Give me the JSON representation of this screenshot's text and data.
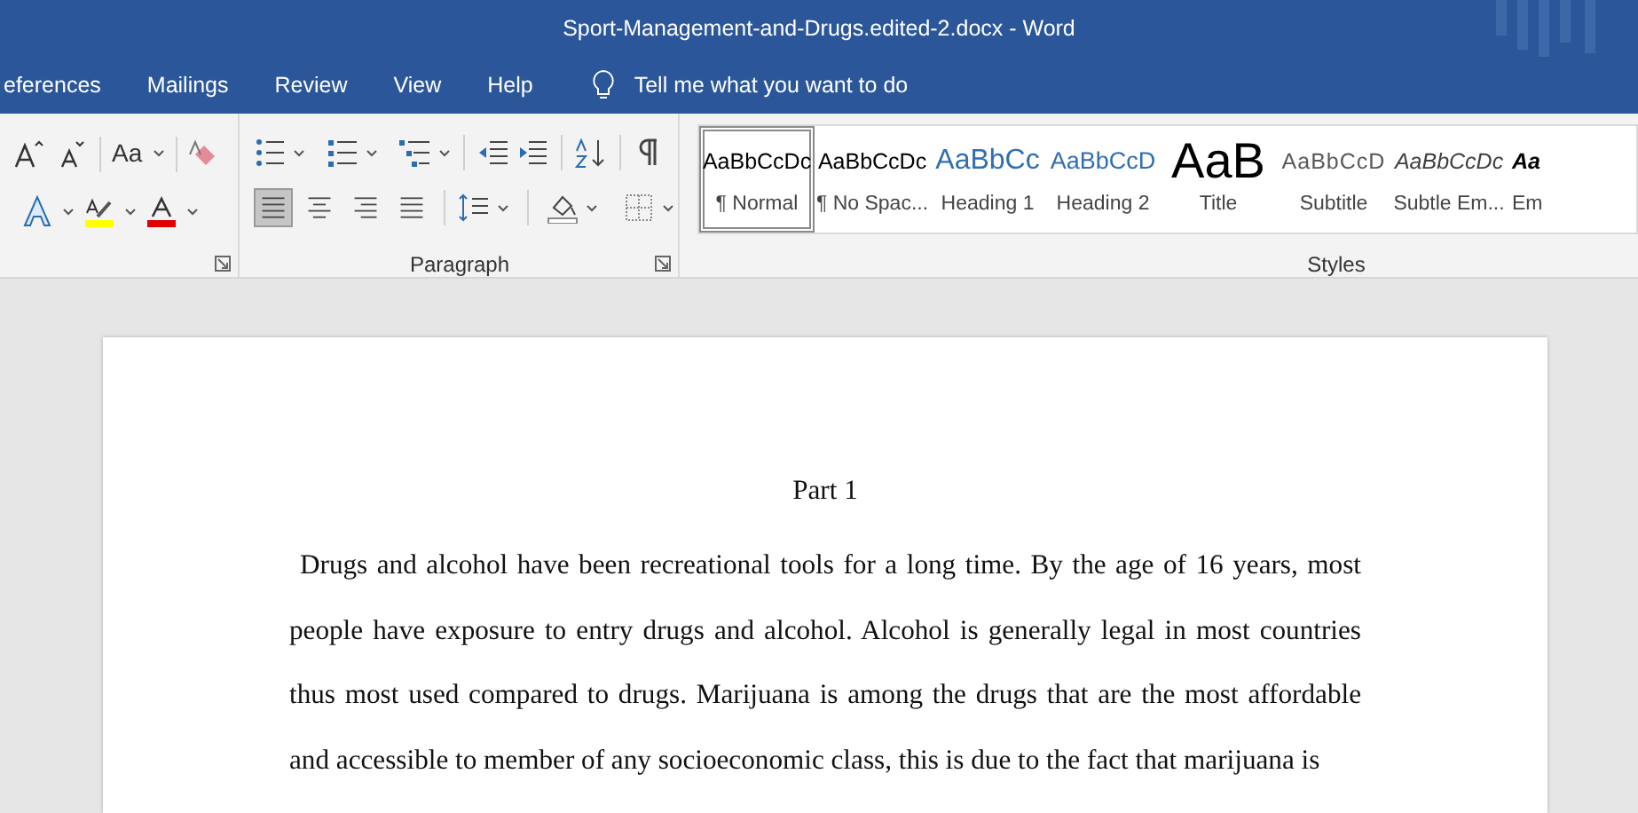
{
  "window": {
    "title": "Sport-Management-and-Drugs.edited-2.docx  -  Word"
  },
  "tabs": [
    {
      "label": "eferences",
      "selected": false
    },
    {
      "label": "Mailings",
      "selected": false
    },
    {
      "label": "Review",
      "selected": false
    },
    {
      "label": "View",
      "selected": false
    },
    {
      "label": "Help",
      "selected": false
    }
  ],
  "tell_me": {
    "placeholder": "Tell me what you want to do"
  },
  "font_group": {
    "change_case": "Aa"
  },
  "paragraph_group": {
    "label": "Paragraph",
    "alignment": [
      {
        "kind": "left",
        "selected": true
      },
      {
        "kind": "center",
        "selected": false
      },
      {
        "kind": "right",
        "selected": false
      },
      {
        "kind": "justify",
        "selected": false
      }
    ]
  },
  "styles": {
    "label": "Styles",
    "items": [
      {
        "preview": "AaBbCcDc",
        "name": "¶ Normal",
        "kind": "normal",
        "selected": true
      },
      {
        "preview": "AaBbCcDc",
        "name": "¶ No Spac...",
        "kind": "normal",
        "selected": false
      },
      {
        "preview": "AaBbCc",
        "name": "Heading 1",
        "kind": "heading1",
        "selected": false
      },
      {
        "preview": "AaBbCcD",
        "name": "Heading 2",
        "kind": "heading2",
        "selected": false
      },
      {
        "preview": "AaB",
        "name": "Title",
        "kind": "title",
        "selected": false
      },
      {
        "preview": "AaBbCcD",
        "name": "Subtitle",
        "kind": "subtitle",
        "selected": false
      },
      {
        "preview": "AaBbCcDc",
        "name": "Subtle Em...",
        "kind": "emphasis",
        "selected": false
      },
      {
        "preview": "Aa",
        "name": "Em",
        "kind": "strong",
        "selected": false
      }
    ]
  },
  "document": {
    "heading": "Part 1",
    "paragraph": "Drugs and alcohol have been recreational tools for a long time. By the age of 16 years, most people have exposure to entry drugs and alcohol. Alcohol is generally legal in most countries thus most used compared to drugs.  Marijuana is among the drugs that are the most affordable and accessible to member of any socioeconomic class, this is due to the fact that marijuana is"
  }
}
